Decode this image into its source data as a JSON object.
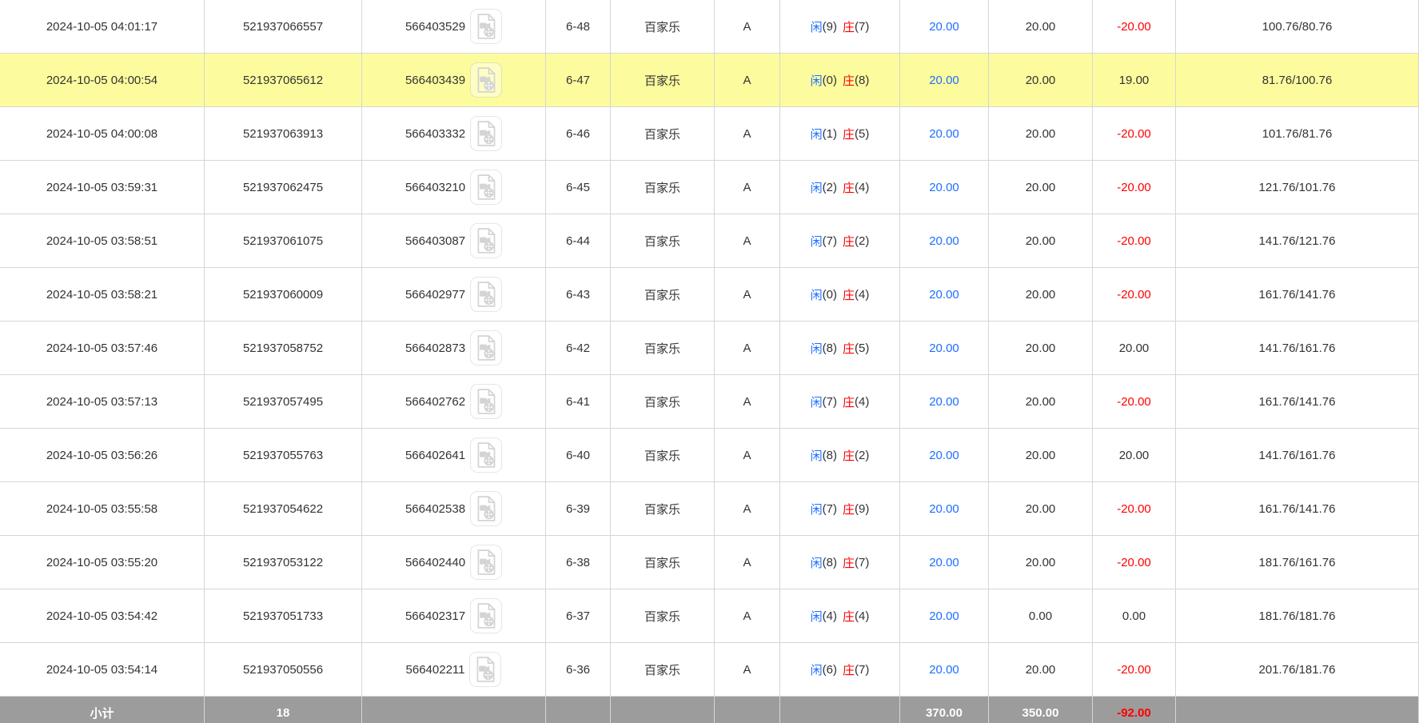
{
  "colors": {
    "accent-blue": "#1e6fff",
    "loss-red": "#ff0000",
    "highlight-yellow": "#fcfc9e",
    "subtotal-gray": "#9c9c9c",
    "text-dark": "#333333",
    "border-gray": "#d6d6d6"
  },
  "icons": {
    "video_replay": "video-file-icon"
  },
  "table": {
    "rows": [
      {
        "time": "2024-10-05 04:01:17",
        "bet_id": "521937066557",
        "round_id": "566403529",
        "round": "6-48",
        "game": "百家乐",
        "table_name": "A",
        "p_label": "闲",
        "p_val": "(9)",
        "b_label": "庄",
        "b_val": "(7)",
        "bet": "20.00",
        "valid": "20.00",
        "winloss": "-20.00",
        "balance": "100.76/80.76",
        "highlighted": false
      },
      {
        "time": "2024-10-05 04:00:54",
        "bet_id": "521937065612",
        "round_id": "566403439",
        "round": "6-47",
        "game": "百家乐",
        "table_name": "A",
        "p_label": "闲",
        "p_val": "(0)",
        "b_label": "庄",
        "b_val": "(8)",
        "bet": "20.00",
        "valid": "20.00",
        "winloss": "19.00",
        "balance": "81.76/100.76",
        "highlighted": true
      },
      {
        "time": "2024-10-05 04:00:08",
        "bet_id": "521937063913",
        "round_id": "566403332",
        "round": "6-46",
        "game": "百家乐",
        "table_name": "A",
        "p_label": "闲",
        "p_val": "(1)",
        "b_label": "庄",
        "b_val": "(5)",
        "bet": "20.00",
        "valid": "20.00",
        "winloss": "-20.00",
        "balance": "101.76/81.76",
        "highlighted": false
      },
      {
        "time": "2024-10-05 03:59:31",
        "bet_id": "521937062475",
        "round_id": "566403210",
        "round": "6-45",
        "game": "百家乐",
        "table_name": "A",
        "p_label": "闲",
        "p_val": "(2)",
        "b_label": "庄",
        "b_val": "(4)",
        "bet": "20.00",
        "valid": "20.00",
        "winloss": "-20.00",
        "balance": "121.76/101.76",
        "highlighted": false
      },
      {
        "time": "2024-10-05 03:58:51",
        "bet_id": "521937061075",
        "round_id": "566403087",
        "round": "6-44",
        "game": "百家乐",
        "table_name": "A",
        "p_label": "闲",
        "p_val": "(7)",
        "b_label": "庄",
        "b_val": "(2)",
        "bet": "20.00",
        "valid": "20.00",
        "winloss": "-20.00",
        "balance": "141.76/121.76",
        "highlighted": false
      },
      {
        "time": "2024-10-05 03:58:21",
        "bet_id": "521937060009",
        "round_id": "566402977",
        "round": "6-43",
        "game": "百家乐",
        "table_name": "A",
        "p_label": "闲",
        "p_val": "(0)",
        "b_label": "庄",
        "b_val": "(4)",
        "bet": "20.00",
        "valid": "20.00",
        "winloss": "-20.00",
        "balance": "161.76/141.76",
        "highlighted": false
      },
      {
        "time": "2024-10-05 03:57:46",
        "bet_id": "521937058752",
        "round_id": "566402873",
        "round": "6-42",
        "game": "百家乐",
        "table_name": "A",
        "p_label": "闲",
        "p_val": "(8)",
        "b_label": "庄",
        "b_val": "(5)",
        "bet": "20.00",
        "valid": "20.00",
        "winloss": "20.00",
        "balance": "141.76/161.76",
        "highlighted": false
      },
      {
        "time": "2024-10-05 03:57:13",
        "bet_id": "521937057495",
        "round_id": "566402762",
        "round": "6-41",
        "game": "百家乐",
        "table_name": "A",
        "p_label": "闲",
        "p_val": "(7)",
        "b_label": "庄",
        "b_val": "(4)",
        "bet": "20.00",
        "valid": "20.00",
        "winloss": "-20.00",
        "balance": "161.76/141.76",
        "highlighted": false
      },
      {
        "time": "2024-10-05 03:56:26",
        "bet_id": "521937055763",
        "round_id": "566402641",
        "round": "6-40",
        "game": "百家乐",
        "table_name": "A",
        "p_label": "闲",
        "p_val": "(8)",
        "b_label": "庄",
        "b_val": "(2)",
        "bet": "20.00",
        "valid": "20.00",
        "winloss": "20.00",
        "balance": "141.76/161.76",
        "highlighted": false
      },
      {
        "time": "2024-10-05 03:55:58",
        "bet_id": "521937054622",
        "round_id": "566402538",
        "round": "6-39",
        "game": "百家乐",
        "table_name": "A",
        "p_label": "闲",
        "p_val": "(7)",
        "b_label": "庄",
        "b_val": "(9)",
        "bet": "20.00",
        "valid": "20.00",
        "winloss": "-20.00",
        "balance": "161.76/141.76",
        "highlighted": false
      },
      {
        "time": "2024-10-05 03:55:20",
        "bet_id": "521937053122",
        "round_id": "566402440",
        "round": "6-38",
        "game": "百家乐",
        "table_name": "A",
        "p_label": "闲",
        "p_val": "(8)",
        "b_label": "庄",
        "b_val": "(7)",
        "bet": "20.00",
        "valid": "20.00",
        "winloss": "-20.00",
        "balance": "181.76/161.76",
        "highlighted": false
      },
      {
        "time": "2024-10-05 03:54:42",
        "bet_id": "521937051733",
        "round_id": "566402317",
        "round": "6-37",
        "game": "百家乐",
        "table_name": "A",
        "p_label": "闲",
        "p_val": "(4)",
        "b_label": "庄",
        "b_val": "(4)",
        "bet": "20.00",
        "valid": "0.00",
        "winloss": "0.00",
        "balance": "181.76/181.76",
        "highlighted": false
      },
      {
        "time": "2024-10-05 03:54:14",
        "bet_id": "521937050556",
        "round_id": "566402211",
        "round": "6-36",
        "game": "百家乐",
        "table_name": "A",
        "p_label": "闲",
        "p_val": "(6)",
        "b_label": "庄",
        "b_val": "(7)",
        "bet": "20.00",
        "valid": "20.00",
        "winloss": "-20.00",
        "balance": "201.76/181.76",
        "highlighted": false
      }
    ],
    "subtotal": {
      "label": "小计",
      "count": "18",
      "bet_total": "370.00",
      "valid_total": "350.00",
      "winloss_total": "-92.00"
    }
  }
}
